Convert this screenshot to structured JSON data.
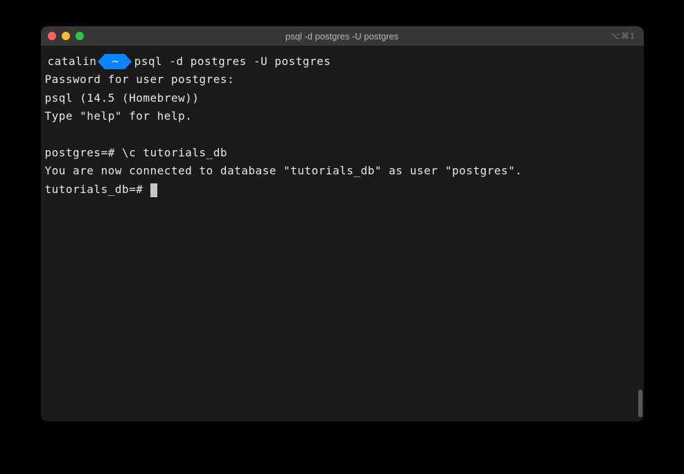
{
  "window": {
    "title": "psql -d postgres -U postgres",
    "shortcut_indicator": "⌥⌘1"
  },
  "prompt": {
    "user": "catalin",
    "path": "~",
    "command": "psql -d postgres -U postgres"
  },
  "output": {
    "password_prompt": "Password for user postgres:",
    "version_line": "psql (14.5 (Homebrew))",
    "help_line": "Type \"help\" for help.",
    "db_prompt1": "postgres=# \\c tutorials_db",
    "connected_line": "You are now connected to database \"tutorials_db\" as user \"postgres\".",
    "db_prompt2": "tutorials_db=# "
  }
}
